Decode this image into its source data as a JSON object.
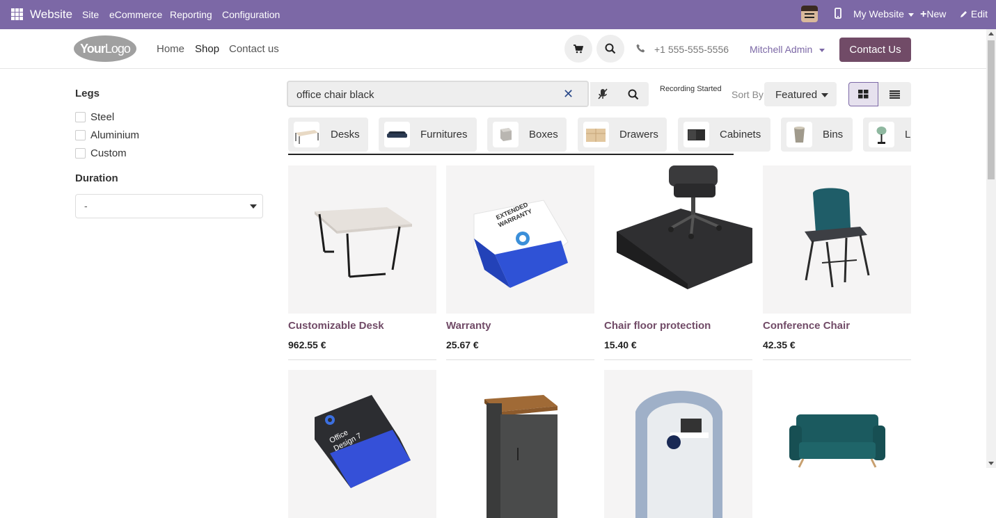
{
  "adminbar": {
    "brand": "Website",
    "menu": [
      "Site",
      "eCommerce",
      "Reporting",
      "Configuration"
    ],
    "website_switcher": "My Website",
    "new_label": "New",
    "edit_label": "Edit"
  },
  "header": {
    "logo_bold": "Your",
    "logo_thin": "Logo",
    "nav": [
      "Home",
      "Shop",
      "Contact us"
    ],
    "phone": "+1 555-555-5556",
    "user": "Mitchell Admin",
    "contact_button": "Contact Us"
  },
  "filters": {
    "legs_title": "Legs",
    "legs_options": [
      "Steel",
      "Aluminium",
      "Custom"
    ],
    "duration_title": "Duration",
    "duration_value": "-"
  },
  "search": {
    "value": "office chair black",
    "recording_status": "Recording Started",
    "sort_label": "Sort By:",
    "sort_value": "Featured"
  },
  "categories": [
    "Desks",
    "Furnitures",
    "Boxes",
    "Drawers",
    "Cabinets",
    "Bins",
    "La"
  ],
  "products": [
    {
      "name": "Customizable Desk",
      "price": "962.55 €"
    },
    {
      "name": "Warranty",
      "price": "25.67 €"
    },
    {
      "name": "Chair floor protection",
      "price": "15.40 €"
    },
    {
      "name": "Conference Chair",
      "price": "42.35 €"
    }
  ],
  "products_row2_box_text": "Office Design 7",
  "warranty_box_text": "EXTENDED WARRANTY",
  "colors": {
    "admin_bar": "#7c68a6",
    "brand_primary": "#714b67"
  }
}
